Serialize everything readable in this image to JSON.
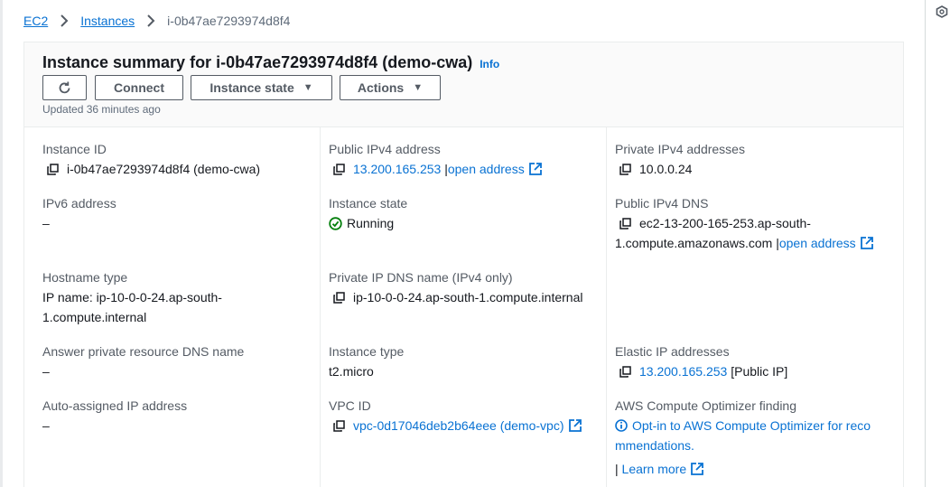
{
  "breadcrumb": {
    "root": "EC2",
    "instances": "Instances",
    "current": "i-0b47ae7293974d8f4"
  },
  "header": {
    "title": "Instance summary for i-0b47ae7293974d8f4 (demo-cwa)",
    "info": "Info",
    "connect": "Connect",
    "instance_state": "Instance state",
    "actions": "Actions",
    "updated": "Updated 36 minutes ago"
  },
  "fields": {
    "instance_id": {
      "label": "Instance ID",
      "value": "i-0b47ae7293974d8f4 (demo-cwa)"
    },
    "public_ipv4": {
      "label": "Public IPv4 address",
      "value": "13.200.165.253",
      "sep": "|",
      "link": "open address"
    },
    "private_ipv4": {
      "label": "Private IPv4 addresses",
      "value": "10.0.0.24"
    },
    "ipv6": {
      "label": "IPv6 address",
      "value": "–"
    },
    "instance_state": {
      "label": "Instance state",
      "value": "Running"
    },
    "public_dns": {
      "label": "Public IPv4 DNS",
      "line1": "ec2-13-200-165-253.ap-south-",
      "line2": "1.compute.amazonaws.com",
      "sep": "|",
      "link": "open address"
    },
    "hostname_type": {
      "label": "Hostname type",
      "line1": "IP name: ip-10-0-0-24.ap-south-",
      "line2": "1.compute.internal"
    },
    "private_dns": {
      "label": "Private IP DNS name (IPv4 only)",
      "value": "ip-10-0-0-24.ap-south-1.compute.internal"
    },
    "answer_dns": {
      "label": "Answer private resource DNS name",
      "value": "–"
    },
    "instance_type": {
      "label": "Instance type",
      "value": "t2.micro"
    },
    "elastic_ip": {
      "label": "Elastic IP addresses",
      "value": "13.200.165.253",
      "suffix": "[Public IP]"
    },
    "auto_ip": {
      "label": "Auto-assigned IP address",
      "value": "–"
    },
    "vpc_id": {
      "label": "VPC ID",
      "value": "vpc-0d17046deb2b64eee (demo-vpc)"
    },
    "optimizer": {
      "label": "AWS Compute Optimizer finding",
      "line1": "Opt-in to AWS Compute Optimizer for reco",
      "line2": "mmendations.",
      "sep": "|",
      "learn": "Learn more"
    }
  },
  "colors": {
    "link": "#0972d3",
    "success": "#037f0c",
    "border": "#eaeded",
    "label": "#545b64"
  },
  "icons": [
    "chevron-right-icon",
    "refresh-icon",
    "caret-down-icon",
    "copy-icon",
    "external-link-icon",
    "status-running-icon",
    "info-circle-icon",
    "hexagon-icon"
  ]
}
